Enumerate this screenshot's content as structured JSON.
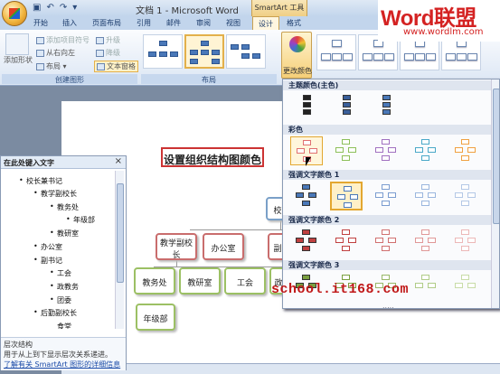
{
  "window": {
    "title": "文档 1 - Microsoft Word",
    "contextual_tab_group": "SmartArt 工具"
  },
  "brand": {
    "name_latin": "Word",
    "name_cn": "联盟",
    "url": "www.wordlm.com"
  },
  "tabs": [
    {
      "label": "开始"
    },
    {
      "label": "插入"
    },
    {
      "label": "页面布局"
    },
    {
      "label": "引用"
    },
    {
      "label": "邮件"
    },
    {
      "label": "审阅"
    },
    {
      "label": "视图"
    },
    {
      "label": "设计",
      "active": true
    },
    {
      "label": "格式"
    }
  ],
  "ribbon": {
    "create_graphic": {
      "add_bullet": "添加项目符号",
      "right_to_left": "从右向左",
      "layout": "布局",
      "add_shape": "添加形状",
      "promote": "升级",
      "demote": "降级",
      "text_pane": "文本窗格",
      "group_label": "创建图形"
    },
    "layouts_group_label": "布局",
    "change_colors": "更改颜色"
  },
  "document": {
    "heading": "设置组织结构图颜色",
    "org_nodes": {
      "top": "校",
      "l1_a": "教学副校长",
      "l1_b": "办公室",
      "l1_c": "副",
      "l2_a": "教务处",
      "l2_b": "教研室",
      "l2_c": "工会",
      "l2_d": "政",
      "l3_a": "年级部"
    }
  },
  "text_pane": {
    "title": "在此处键入文字",
    "close": "×",
    "items": [
      {
        "text": "校长兼书记",
        "level": 0
      },
      {
        "text": "教学副校长",
        "level": 1
      },
      {
        "text": "教务处",
        "level": 2
      },
      {
        "text": "年级部",
        "level": 3
      },
      {
        "text": "教研室",
        "level": 2
      },
      {
        "text": "办公室",
        "level": 1
      },
      {
        "text": "副书记",
        "level": 1
      },
      {
        "text": "工会",
        "level": 2
      },
      {
        "text": "政教务",
        "level": 2
      },
      {
        "text": "团委",
        "level": 2
      },
      {
        "text": "后勤副校长",
        "level": 1
      },
      {
        "text": "食堂",
        "level": 2
      }
    ],
    "footer": {
      "title": "层次结构",
      "desc": "用于从上到下显示层次关系递进。",
      "link": "了解有关 SmartArt 图形的详细信息"
    }
  },
  "color_dropdown": {
    "sections": [
      {
        "title": "主题颜色(主色)",
        "swatches": [
          "#222222",
          "#3a5f9a",
          "#4a78b8"
        ]
      },
      {
        "title": "彩色",
        "swatches": [
          "#e07070",
          "#8cbf5a",
          "#a070c0",
          "#4aa8c8",
          "#f0a040"
        ]
      },
      {
        "title": "强调文字颜色 1",
        "swatches": [
          "#4a78b8",
          "#4a78b8",
          "#7a9cd0",
          "#9ab6de",
          "#b4c8e6"
        ]
      },
      {
        "title": "强调文字颜色 2",
        "swatches": [
          "#c04040",
          "#c04040",
          "#d07070",
          "#e09898",
          "#ecb8b8"
        ]
      },
      {
        "title": "强调文字颜色 3",
        "swatches": [
          "#7aa040",
          "#7aa040",
          "#98b868",
          "#b0cc88",
          "#c8dca8"
        ]
      }
    ],
    "more": "....."
  },
  "watermark": "school.it168.com",
  "colors": {
    "accent_orange": "#e3b04a",
    "heading_border": "#cc3333",
    "node_red": "#c96d6d",
    "node_green": "#9cc064"
  }
}
